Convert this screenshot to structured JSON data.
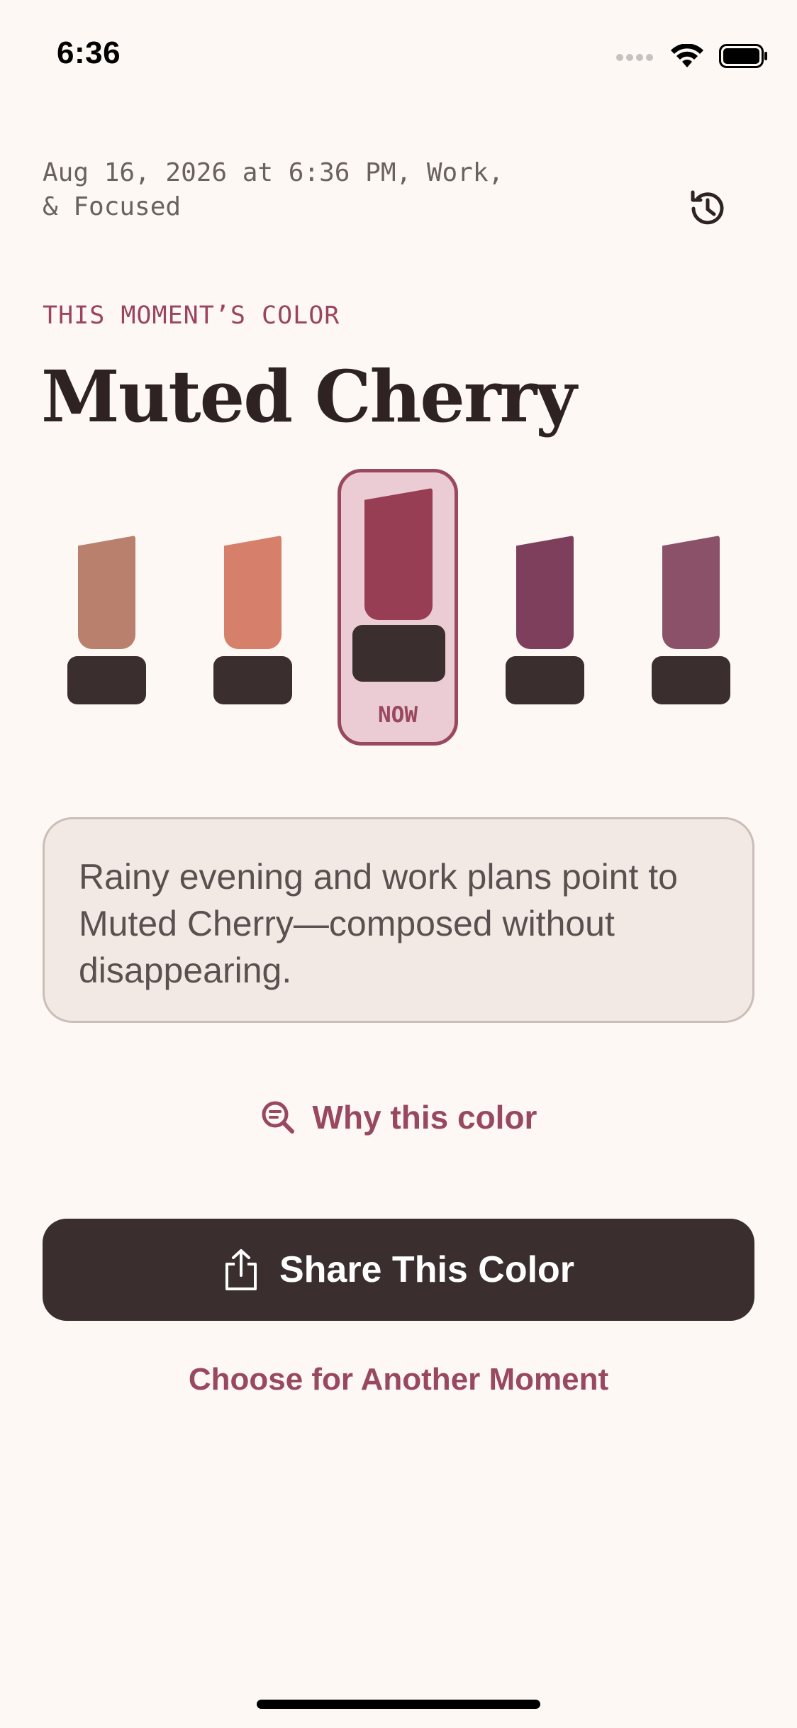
{
  "status_bar": {
    "time": "6:36"
  },
  "header": {
    "context": "Aug 16, 2026 at 6:36 PM, Work,\n& Focused",
    "history_icon": "history-clock-icon"
  },
  "moment": {
    "eyebrow": "THIS MOMENT’S COLOR",
    "color_name": "Muted Cherry"
  },
  "lipsticks": [
    {
      "color": "#b9806d",
      "selected": false
    },
    {
      "color": "#d67f6b",
      "selected": false
    },
    {
      "color": "#973e54",
      "selected": true,
      "badge": "NOW"
    },
    {
      "color": "#7e3f5d",
      "selected": false
    },
    {
      "color": "#8b5168",
      "selected": false
    }
  ],
  "description": {
    "text": "Rainy evening and work plans point to Muted Cherry—composed without disappearing."
  },
  "why_link": {
    "label": "Why this color",
    "icon": "search-detail-icon"
  },
  "share_button": {
    "label": "Share This Color",
    "icon": "share-icon"
  },
  "another_link": {
    "label": "Choose for Another Moment"
  },
  "colors": {
    "background": "#fdf8f4",
    "accent": "#98485f",
    "dark": "#3a2f2e",
    "card": "#f3e9e4"
  }
}
